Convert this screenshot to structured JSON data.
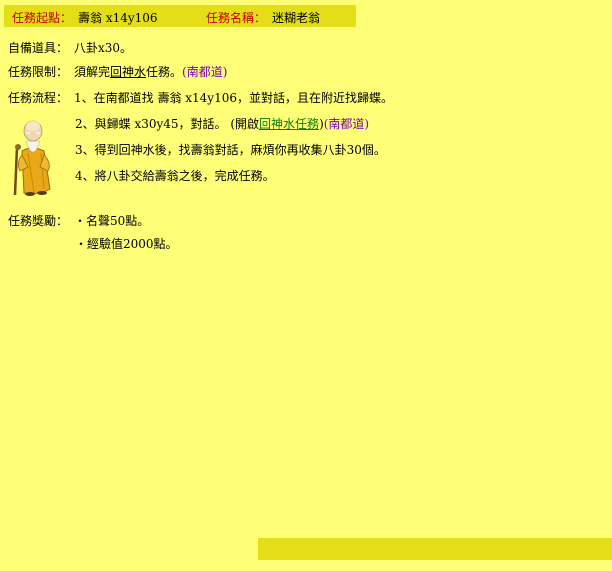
{
  "header": {
    "start_label": "任務起點：",
    "start_value": "壽翁 x14y106",
    "name_label": "任務名稱：",
    "name_value": "迷糊老翁"
  },
  "prep": {
    "label": "自備道具：",
    "value": "八卦x30。"
  },
  "restriction": {
    "label": "任務限制：",
    "prefix": "須解完",
    "link": "回神水",
    "suffix": "任務。",
    "location": "(南都道)"
  },
  "flow": {
    "label": "任務流程：",
    "step1": "1、在南都道找 壽翁 x14y106，並對話，且在附近找歸蝶。",
    "step2_prefix": "2、與歸蝶 x30y45，對話。 (開啟",
    "step2_link": "回神水任務",
    "step2_close": ")",
    "step2_location": "(南都道)",
    "step3": "3、得到回神水後，找壽翁對話，麻煩你再收集八卦30個。",
    "step4": "4、將八卦交給壽翁之後，完成任務。"
  },
  "reward": {
    "label": "任務獎勵：",
    "item1": "・名聲50點。",
    "item2": "・經驗值2000點。"
  },
  "colors": {
    "background": "#ffff77",
    "bar": "#e4de18",
    "label_red": "#c00000",
    "location_purple": "#7a00b8",
    "link_green": "#0a7a0a"
  }
}
